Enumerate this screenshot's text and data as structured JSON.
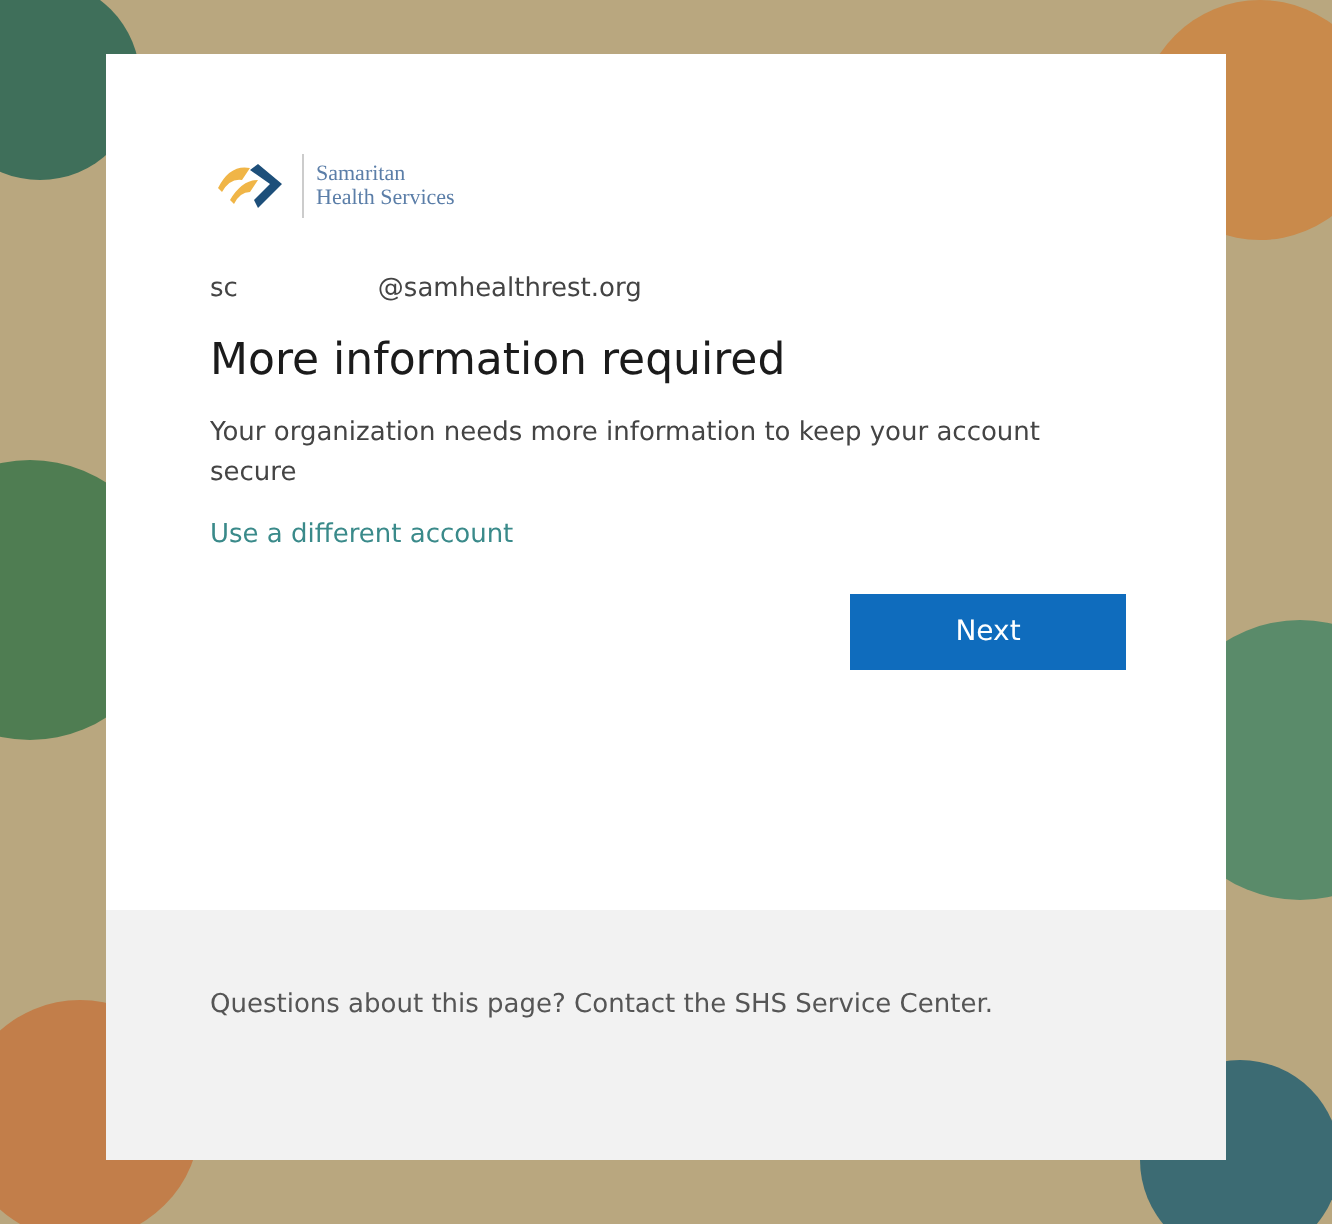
{
  "logo": {
    "line_1": "Samaritan",
    "line_2": "Health Services"
  },
  "account": {
    "user": "sc",
    "domain": "@samhealthrest.org"
  },
  "title": "More information required",
  "message": "Your organization needs more information to keep your account secure",
  "link": "Use a different account",
  "button": "Next",
  "footer": "Questions about this page? Contact the SHS Service Center."
}
